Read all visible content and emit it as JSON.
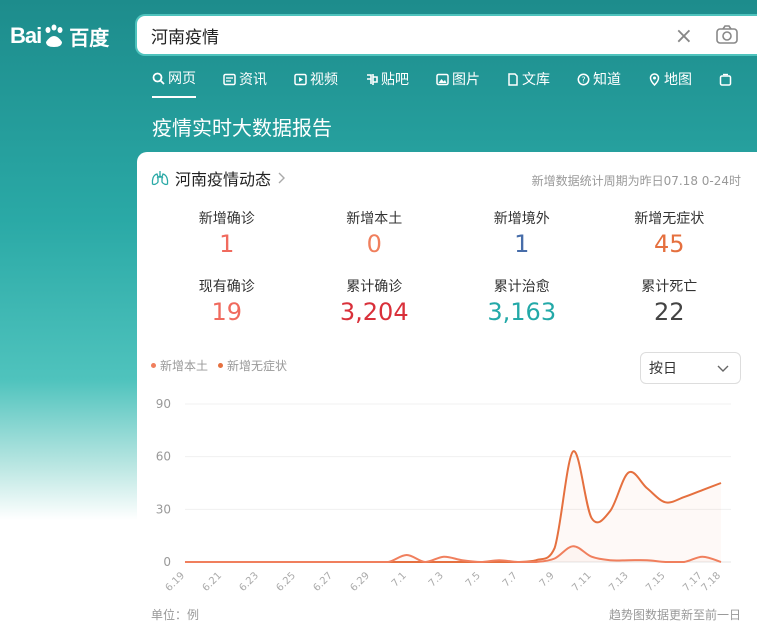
{
  "logo": {
    "latin": "Bai",
    "du": "du",
    "cn": "百度"
  },
  "search": {
    "value": "河南疫情",
    "clear_glyph": "×"
  },
  "nav": [
    {
      "label": "网页",
      "icon": "search-icon",
      "active": true
    },
    {
      "label": "资讯",
      "icon": "news-icon"
    },
    {
      "label": "视频",
      "icon": "video-icon"
    },
    {
      "label": "贴吧",
      "icon": "tieba-icon"
    },
    {
      "label": "图片",
      "icon": "image-icon"
    },
    {
      "label": "文库",
      "icon": "doc-icon"
    },
    {
      "label": "知道",
      "icon": "question-icon"
    },
    {
      "label": "地图",
      "icon": "map-icon"
    }
  ],
  "report_title": "疫情实时大数据报告",
  "card": {
    "title": "河南疫情动态",
    "note": "新增数据统计周期为昨日07.18 0-24时",
    "stats": [
      {
        "label": "新增确诊",
        "value": "1",
        "color": "#f06a5e"
      },
      {
        "label": "新增本土",
        "value": "0",
        "color": "#f07f5d"
      },
      {
        "label": "新增境外",
        "value": "1",
        "color": "#476da9"
      },
      {
        "label": "新增无症状",
        "value": "45",
        "color": "#e5703f"
      },
      {
        "label": "现有确诊",
        "value": "19",
        "color": "#f06a5e"
      },
      {
        "label": "累计确诊",
        "value": "3,204",
        "color": "#d9303a"
      },
      {
        "label": "累计治愈",
        "value": "3,163",
        "color": "#23a9a8"
      },
      {
        "label": "累计死亡",
        "value": "22",
        "color": "#444444"
      }
    ],
    "select_value": "按日",
    "foot_left": "单位：例",
    "foot_right": "趋势图数据更新至前一日"
  },
  "chart_data": {
    "type": "line",
    "x": [
      "6.19",
      "6.20",
      "6.21",
      "6.22",
      "6.23",
      "6.24",
      "6.25",
      "6.26",
      "6.27",
      "6.28",
      "6.29",
      "6.30",
      "7.1",
      "7.2",
      "7.3",
      "7.4",
      "7.5",
      "7.6",
      "7.7",
      "7.8",
      "7.9",
      "7.10",
      "7.11",
      "7.12",
      "7.13",
      "7.14",
      "7.15",
      "7.16",
      "7.17",
      "7.18"
    ],
    "x_tick_labels": [
      "6.19",
      "6.21",
      "6.23",
      "6.25",
      "6.27",
      "6.29",
      "7.1",
      "7.3",
      "7.5",
      "7.7",
      "7.9",
      "7.11",
      "7.13",
      "7.15",
      "7.17",
      "7.18"
    ],
    "series": [
      {
        "name": "新增本土",
        "color": "#f07f5d",
        "values": [
          0,
          0,
          0,
          0,
          0,
          0,
          0,
          0,
          0,
          0,
          0,
          0,
          4,
          0,
          3,
          1,
          0,
          1,
          0,
          0,
          2,
          9,
          3,
          1,
          1,
          1,
          0,
          0,
          3,
          0
        ]
      },
      {
        "name": "新增无症状",
        "color": "#e5703f",
        "values": [
          0,
          0,
          0,
          0,
          0,
          0,
          0,
          0,
          0,
          0,
          0,
          0,
          0,
          0,
          0,
          0,
          0,
          0,
          0,
          1,
          8,
          63,
          25,
          29,
          51,
          42,
          34,
          37,
          41,
          45
        ]
      }
    ],
    "yticks": [
      0,
      30,
      60,
      90
    ],
    "ylim": [
      0,
      90
    ],
    "legend": "top-left",
    "grid": true
  }
}
